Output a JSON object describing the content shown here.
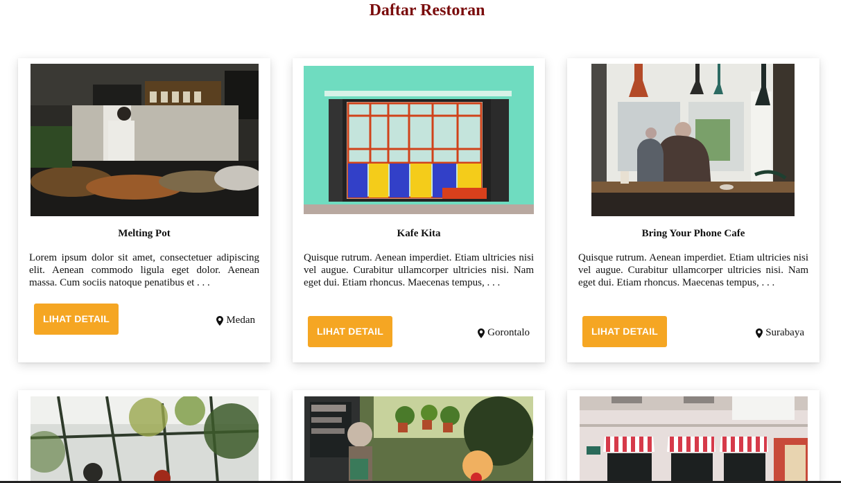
{
  "page": {
    "title": "Daftar Restoran"
  },
  "restaurants": [
    {
      "name": "Melting Pot",
      "description": "Lorem ipsum dolor sit amet, consectetuer adipiscing elit. Aenean commodo ligula eget dolor. Aenean massa. Cum sociis natoque penatibus et . . .",
      "button_label": "LIHAT DETAIL",
      "city": "Medan",
      "location_icon": "map-pin-icon"
    },
    {
      "name": "Kafe Kita",
      "description": "Quisque rutrum. Aenean imperdiet. Etiam ultricies nisi vel augue. Curabitur ullamcorper ultricies nisi. Nam eget dui. Etiam rhoncus. Maecenas tempus, . . .",
      "button_label": "LIHAT DETAIL",
      "city": "Gorontalo",
      "location_icon": "map-pin-icon"
    },
    {
      "name": "Bring Your Phone Cafe",
      "description": "Quisque rutrum. Aenean imperdiet. Etiam ultricies nisi vel augue. Curabitur ullamcorper ultricies nisi. Nam eget dui. Etiam rhoncus. Maecenas tempus, . . .",
      "button_label": "LIHAT DETAIL",
      "city": "Surabaya",
      "location_icon": "map-pin-icon"
    },
    {
      "image": "greenhouse-cafe-photo"
    },
    {
      "image": "garden-cafe-photo"
    },
    {
      "image": "storefront-awning-photo"
    }
  ],
  "colors": {
    "title": "#7a0c0c",
    "button": "#f5a623",
    "button_text": "#ffffff"
  }
}
